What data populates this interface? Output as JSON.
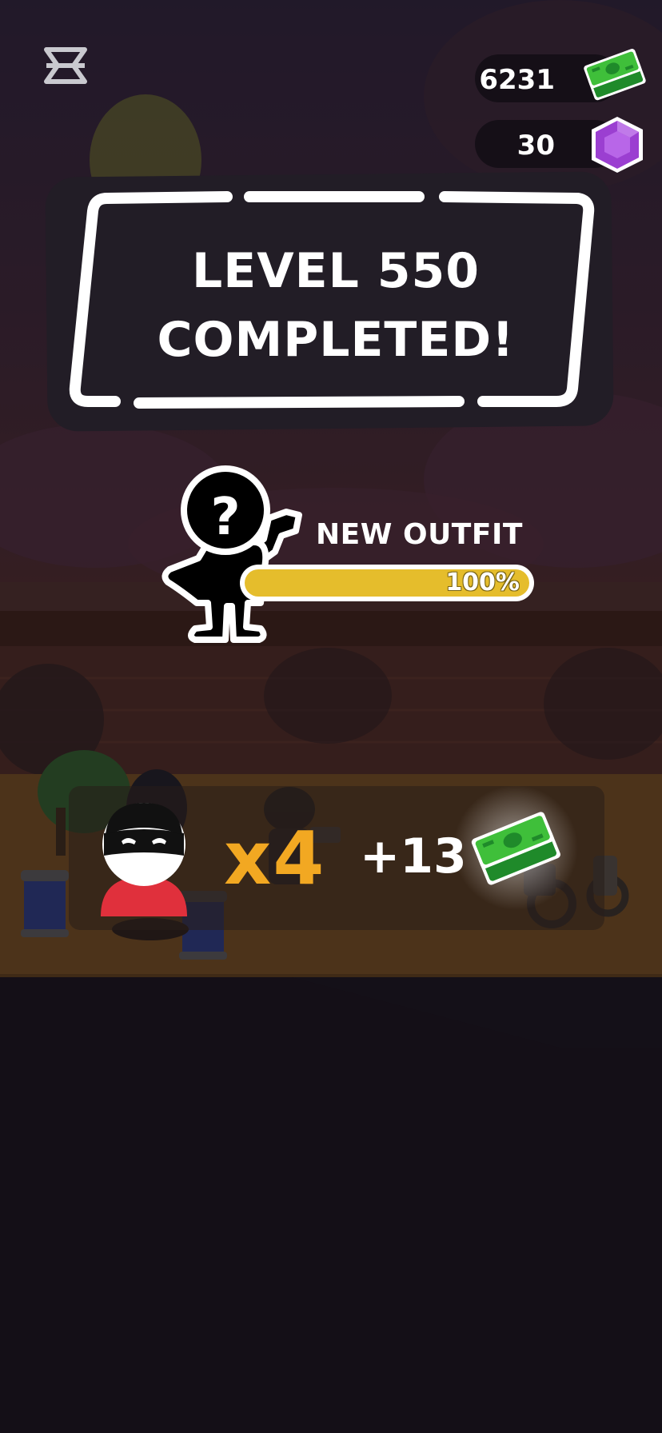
{
  "currency": {
    "cash": "6231",
    "gems": "30",
    "cash_icon": "cash-stack-icon",
    "gem_icon": "purple-gem-icon"
  },
  "banner": {
    "line1": "LEVEL 550",
    "line2": "COMPLETED!"
  },
  "outfit": {
    "label": "NEW OUTFIT",
    "progress_text": "100%",
    "progress_fraction": 1.0,
    "icon": "mystery-silhouette-icon"
  },
  "reward": {
    "multiplier": "x4",
    "amount": "+13",
    "avatar_icon": "masked-thief-avatar-icon",
    "cash_icon": "glowing-cash-icon"
  },
  "colors": {
    "bar_fill": "#e5bd2c",
    "multiplier": "#f2a822",
    "cash_green": "#3fbf3a",
    "gem_purple": "#9b3fd1"
  }
}
